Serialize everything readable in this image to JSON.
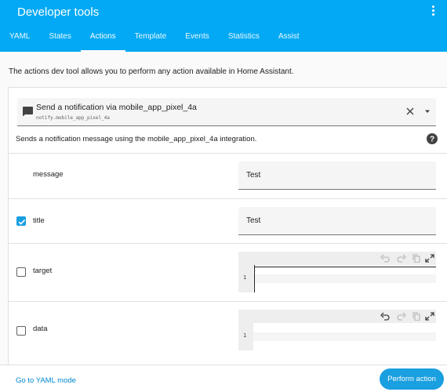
{
  "colors": {
    "primary": "#03a9f4",
    "accent": "#1a9fe0"
  },
  "header": {
    "title": "Developer tools",
    "tabs": [
      {
        "label": "YAML",
        "active": false
      },
      {
        "label": "States",
        "active": false
      },
      {
        "label": "Actions",
        "active": true
      },
      {
        "label": "Template",
        "active": false
      },
      {
        "label": "Events",
        "active": false
      },
      {
        "label": "Statistics",
        "active": false
      },
      {
        "label": "Assist",
        "active": false
      }
    ]
  },
  "intro": "The actions dev tool allows you to perform any action available in Home Assistant.",
  "action_picker": {
    "name": "Send a notification via mobile_app_pixel_4a",
    "id": "notify.mobile_app_pixel_4a",
    "icon": "message-icon"
  },
  "description": "Sends a notification message using the mobile_app_pixel_4a integration.",
  "fields": {
    "message": {
      "label": "message",
      "value": "Test"
    },
    "title": {
      "label": "title",
      "value": "Test",
      "checked": true
    },
    "target": {
      "label": "target",
      "checked": false,
      "line_number": "1"
    },
    "data": {
      "label": "data",
      "checked": false,
      "line_number": "1"
    }
  },
  "footer": {
    "yaml_mode_label": "Go to YAML mode",
    "perform_label": "Perform action"
  }
}
